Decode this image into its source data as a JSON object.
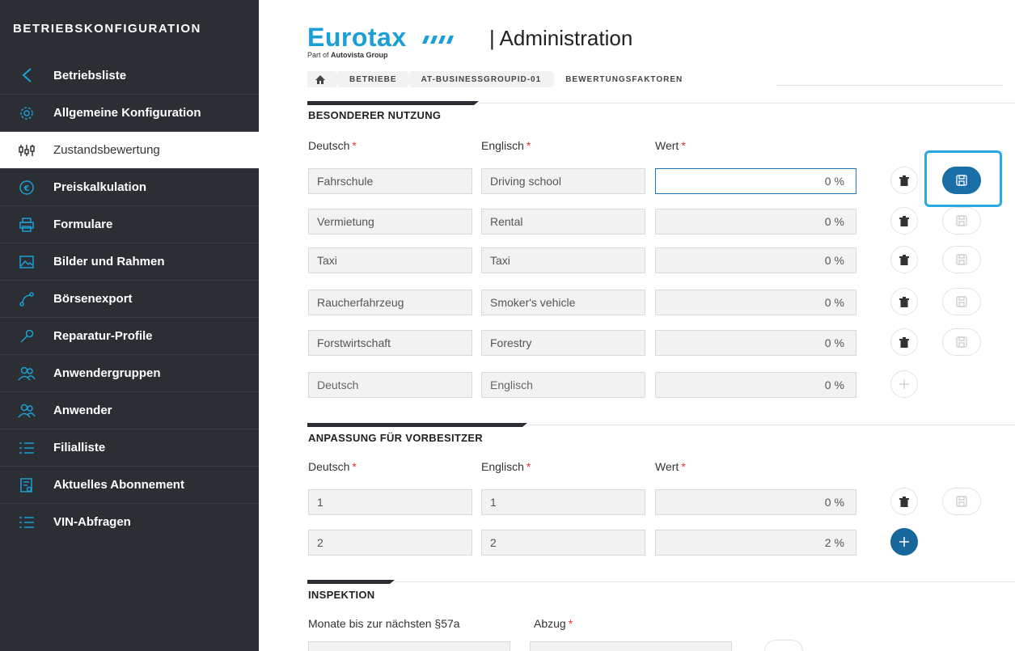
{
  "sidebar": {
    "title": "BETRIEBSKONFIGURATION",
    "items": [
      {
        "label": "Betriebsliste",
        "icon": "chevron-left-icon"
      },
      {
        "label": "Allgemeine Konfiguration",
        "icon": "gear-icon"
      },
      {
        "label": "Zustandsbewertung",
        "icon": "sliders-icon",
        "active": true
      },
      {
        "label": "Preiskalkulation",
        "icon": "euro-icon"
      },
      {
        "label": "Formulare",
        "icon": "printer-icon"
      },
      {
        "label": "Bilder und Rahmen",
        "icon": "image-icon"
      },
      {
        "label": "Börsenexport",
        "icon": "share-icon"
      },
      {
        "label": "Reparatur-Profile",
        "icon": "wrench-icon"
      },
      {
        "label": "Anwendergruppen",
        "icon": "users-icon"
      },
      {
        "label": "Anwender",
        "icon": "user-icon"
      },
      {
        "label": "Filialliste",
        "icon": "list-icon"
      },
      {
        "label": "Aktuelles Abonnement",
        "icon": "document-icon"
      },
      {
        "label": "VIN-Abfragen",
        "icon": "list-icon"
      }
    ]
  },
  "header": {
    "logo_text": "Eurotax",
    "logo_sub_prefix": "Part of",
    "logo_sub_brand": "Autovista Group",
    "title": "| Administration"
  },
  "breadcrumb": [
    "BETRIEBE",
    "AT-BUSINESSGROUPID-01",
    "BEWERTUNGSFAKTOREN"
  ],
  "sections": {
    "besonderer": {
      "title": "BESONDERER NUTZUNG",
      "columns": {
        "deutsch": "Deutsch",
        "englisch": "Englisch",
        "wert": "Wert",
        "required_mark": "*"
      },
      "rows": [
        {
          "deutsch": "Fahrschule",
          "englisch": "Driving school",
          "wert": "0",
          "unit": "%"
        },
        {
          "deutsch": "Vermietung",
          "englisch": "Rental",
          "wert": "0",
          "unit": "%"
        },
        {
          "deutsch": "Taxi",
          "englisch": "Taxi",
          "wert": "0",
          "unit": "%"
        },
        {
          "deutsch": "Raucherfahrzeug",
          "englisch": "Smoker's vehicle",
          "wert": "0",
          "unit": "%"
        },
        {
          "deutsch": "Forstwirtschaft",
          "englisch": "Forestry",
          "wert": "0",
          "unit": "%"
        }
      ],
      "new_row": {
        "deutsch_placeholder": "Deutsch",
        "englisch_placeholder": "Englisch",
        "wert": "0",
        "unit": "%"
      }
    },
    "anpassung": {
      "title": "ANPASSUNG FÜR VORBESITZER",
      "columns": {
        "deutsch": "Deutsch",
        "englisch": "Englisch",
        "wert": "Wert",
        "required_mark": "*"
      },
      "rows": [
        {
          "deutsch": "1",
          "englisch": "1",
          "wert": "0",
          "unit": "%"
        }
      ],
      "new_row": {
        "deutsch": "2",
        "englisch": "2",
        "wert": "2",
        "unit": "%"
      }
    },
    "inspektion": {
      "title": "INSPEKTION",
      "columns": {
        "monate": "Monate bis zur nächsten §57a",
        "abzug": "Abzug",
        "required_mark": "*"
      }
    }
  },
  "colors": {
    "accent": "#1a9fd6",
    "primary_button": "#1a6fa8",
    "sidebar_bg": "#2b2f33",
    "required": "#e0322b",
    "highlight": "#2aa8e0"
  }
}
